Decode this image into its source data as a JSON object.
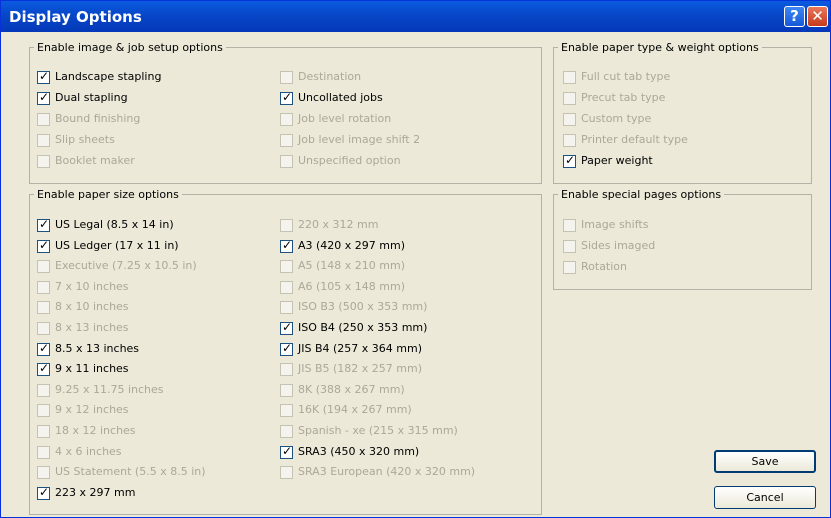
{
  "window": {
    "title": "Display Options",
    "help_label": "?",
    "close_label": "✕"
  },
  "groups": {
    "image_job": {
      "legend": "Enable image & job setup options",
      "col1": [
        {
          "label": "Landscape stapling",
          "checked": true,
          "enabled": true
        },
        {
          "label": "Dual stapling",
          "checked": true,
          "enabled": true
        },
        {
          "label": "Bound  finishing",
          "checked": false,
          "enabled": false
        },
        {
          "label": "Slip sheets",
          "checked": false,
          "enabled": false
        },
        {
          "label": "Booklet maker",
          "checked": false,
          "enabled": false
        }
      ],
      "col2": [
        {
          "label": "Destination",
          "checked": false,
          "enabled": false
        },
        {
          "label": "Uncollated jobs",
          "checked": true,
          "enabled": true
        },
        {
          "label": "Job level rotation",
          "checked": false,
          "enabled": false
        },
        {
          "label": "Job level image shift 2",
          "checked": false,
          "enabled": false
        },
        {
          "label": "Unspecified option",
          "checked": false,
          "enabled": false
        }
      ]
    },
    "paper_size": {
      "legend": "Enable paper size options",
      "col1": [
        {
          "label": "US Legal (8.5 x 14 in)",
          "checked": true,
          "enabled": true
        },
        {
          "label": "US Ledger (17 x 11 in)",
          "checked": true,
          "enabled": true
        },
        {
          "label": "Executive (7.25 x 10.5 in)",
          "checked": false,
          "enabled": false
        },
        {
          "label": "7 x 10 inches",
          "checked": false,
          "enabled": false
        },
        {
          "label": "8 x 10 inches",
          "checked": false,
          "enabled": false
        },
        {
          "label": "8 x 13 inches",
          "checked": false,
          "enabled": false
        },
        {
          "label": "8.5 x 13 inches",
          "checked": true,
          "enabled": true
        },
        {
          "label": "9 x 11 inches",
          "checked": true,
          "enabled": true
        },
        {
          "label": "9.25 x 11.75 inches",
          "checked": false,
          "enabled": false
        },
        {
          "label": "9 x 12 inches",
          "checked": false,
          "enabled": false
        },
        {
          "label": "18 x 12 inches",
          "checked": false,
          "enabled": false
        },
        {
          "label": "4 x 6 inches",
          "checked": false,
          "enabled": false
        },
        {
          "label": "US Statement (5.5 x 8.5 in)",
          "checked": false,
          "enabled": false
        },
        {
          "label": "223 x 297 mm",
          "checked": true,
          "enabled": true
        }
      ],
      "col2": [
        {
          "label": "220 x 312 mm",
          "checked": false,
          "enabled": false
        },
        {
          "label": "A3 (420 x 297 mm)",
          "checked": true,
          "enabled": true
        },
        {
          "label": "A5 (148 x 210 mm)",
          "checked": false,
          "enabled": false
        },
        {
          "label": "A6 (105 x 148 mm)",
          "checked": false,
          "enabled": false
        },
        {
          "label": "ISO B3 (500 x 353 mm)",
          "checked": false,
          "enabled": false
        },
        {
          "label": "ISO B4 (250 x 353 mm)",
          "checked": true,
          "enabled": true
        },
        {
          "label": "JIS B4 (257 x 364 mm)",
          "checked": true,
          "enabled": true
        },
        {
          "label": "JIS B5 (182 x 257 mm)",
          "checked": false,
          "enabled": false
        },
        {
          "label": "8K (388 x 267 mm)",
          "checked": false,
          "enabled": false
        },
        {
          "label": "16K (194 x 267 mm)",
          "checked": false,
          "enabled": false
        },
        {
          "label": "Spanish - xe (215 x 315 mm)",
          "checked": false,
          "enabled": false
        },
        {
          "label": "SRA3 (450 x 320 mm)",
          "checked": true,
          "enabled": true
        },
        {
          "label": "SRA3 European (420 x 320 mm)",
          "checked": false,
          "enabled": false
        }
      ]
    },
    "paper_type": {
      "legend": "Enable paper type & weight options",
      "items": [
        {
          "label": "Full cut tab type",
          "checked": false,
          "enabled": false
        },
        {
          "label": "Precut tab type",
          "checked": false,
          "enabled": false
        },
        {
          "label": "Custom type",
          "checked": false,
          "enabled": false
        },
        {
          "label": "Printer default type",
          "checked": false,
          "enabled": false
        },
        {
          "label": "Paper weight",
          "checked": true,
          "enabled": true
        }
      ]
    },
    "special_pages": {
      "legend": "Enable special pages options",
      "items": [
        {
          "label": "Image shifts",
          "checked": false,
          "enabled": false
        },
        {
          "label": "Sides imaged",
          "checked": false,
          "enabled": false
        },
        {
          "label": "Rotation",
          "checked": false,
          "enabled": false
        }
      ]
    }
  },
  "buttons": {
    "save": "Save",
    "cancel": "Cancel"
  }
}
